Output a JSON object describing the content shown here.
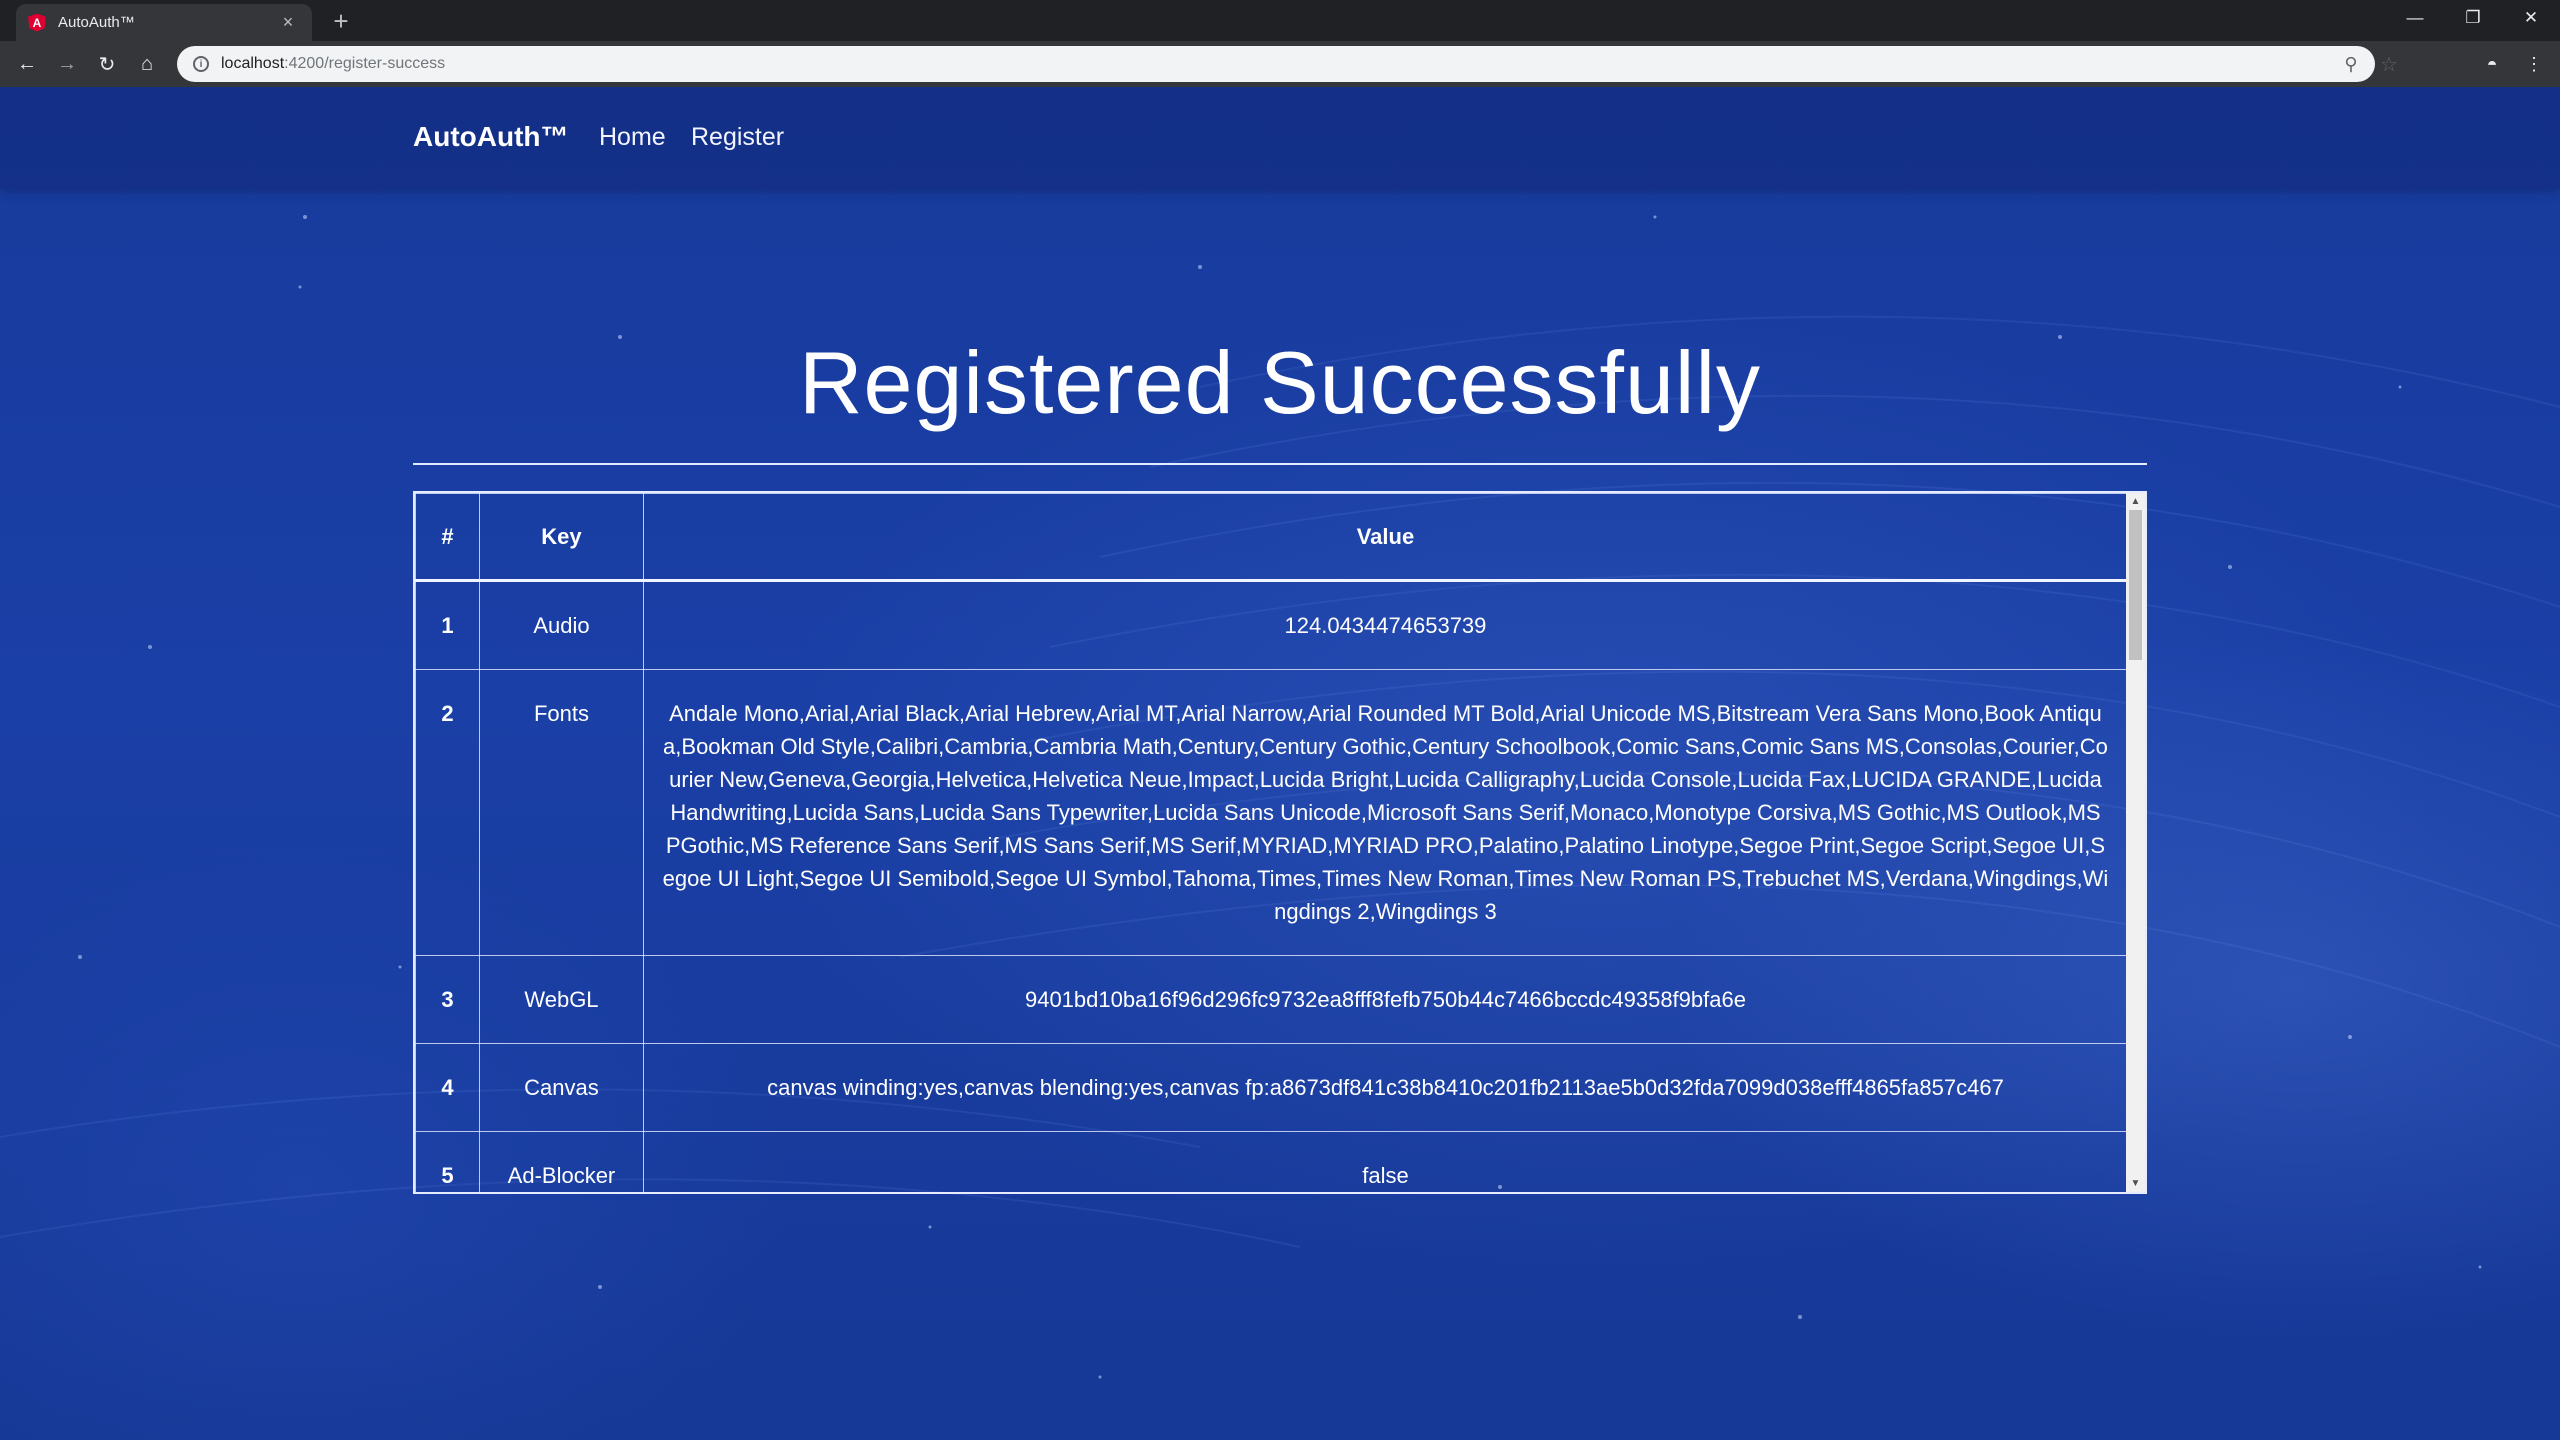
{
  "browser": {
    "tab_title": "AutoAuth™",
    "tab_close": "×",
    "new_tab": "+",
    "url_host": "localhost",
    "url_path": ":4200/register-success",
    "win_minimize": "—",
    "win_restore": "❐",
    "win_close": "✕"
  },
  "navbar": {
    "brand": "AutoAuth™",
    "links": [
      "Home",
      "Register"
    ]
  },
  "main": {
    "title": "Registered Successfully",
    "table": {
      "headers": [
        "#",
        "Key",
        "Value"
      ],
      "rows": [
        {
          "num": "1",
          "key": "Audio",
          "value": "124.0434474653739"
        },
        {
          "num": "2",
          "key": "Fonts",
          "value": "Andale Mono,Arial,Arial Black,Arial Hebrew,Arial MT,Arial Narrow,Arial Rounded MT Bold,Arial Unicode MS,Bitstream Vera Sans Mono,Book Antiqua,Bookman Old Style,Calibri,Cambria,Cambria Math,Century,Century Gothic,Century Schoolbook,Comic Sans,Comic Sans MS,Consolas,Courier,Courier New,Geneva,Georgia,Helvetica,Helvetica Neue,Impact,Lucida Bright,Lucida Calligraphy,Lucida Console,Lucida Fax,LUCIDA GRANDE,Lucida Handwriting,Lucida Sans,Lucida Sans Typewriter,Lucida Sans Unicode,Microsoft Sans Serif,Monaco,Monotype Corsiva,MS Gothic,MS Outlook,MS PGothic,MS Reference Sans Serif,MS Sans Serif,MS Serif,MYRIAD,MYRIAD PRO,Palatino,Palatino Linotype,Segoe Print,Segoe Script,Segoe UI,Segoe UI Light,Segoe UI Semibold,Segoe UI Symbol,Tahoma,Times,Times New Roman,Times New Roman PS,Trebuchet MS,Verdana,Wingdings,Wingdings 2,Wingdings 3"
        },
        {
          "num": "3",
          "key": "WebGL",
          "value": "9401bd10ba16f96d296fc9732ea8fff8fefb750b44c7466bccdc49358f9bfa6e"
        },
        {
          "num": "4",
          "key": "Canvas",
          "value": "canvas winding:yes,canvas blending:yes,canvas fp:a8673df841c38b8410c201fb2113ae5b0d32fda7099d038efff4865fa857c467"
        },
        {
          "num": "5",
          "key": "Ad-Blocker",
          "value": "false"
        }
      ]
    }
  },
  "colors": {
    "page_background": "#173a9c",
    "text": "#ffffff",
    "browser_frame": "#202124"
  }
}
